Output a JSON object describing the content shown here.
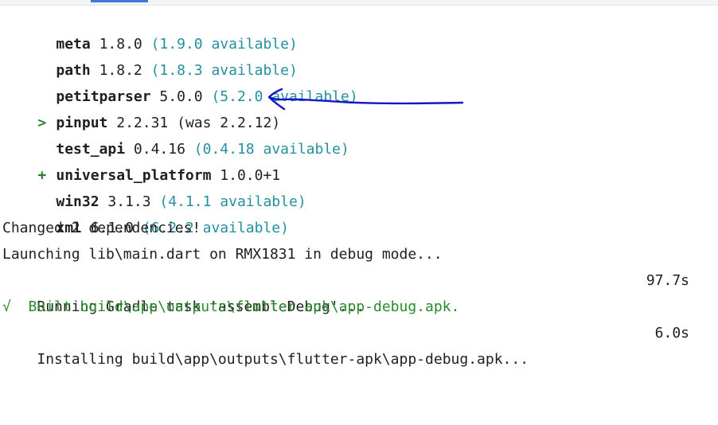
{
  "console": {
    "dependencies": [
      {
        "marker": "",
        "name": "meta",
        "version": "1.8.0",
        "available": "(1.9.0 available)",
        "note": ""
      },
      {
        "marker": "",
        "name": "path",
        "version": "1.8.2",
        "available": "(1.8.3 available)",
        "note": ""
      },
      {
        "marker": "",
        "name": "petitparser",
        "version": "5.0.0",
        "available": "(5.2.0 available)",
        "note": ""
      },
      {
        "marker": ">",
        "name": "pinput",
        "version": "2.2.31",
        "available": "",
        "note": "(was 2.2.12)"
      },
      {
        "marker": "",
        "name": "test_api",
        "version": "0.4.16",
        "available": "(0.4.18 available)",
        "note": ""
      },
      {
        "marker": "+",
        "name": "universal_platform",
        "version": "1.0.0+1",
        "available": "",
        "note": ""
      },
      {
        "marker": "",
        "name": "win32",
        "version": "3.1.3",
        "available": "(4.1.1 available)",
        "note": ""
      },
      {
        "marker": "",
        "name": "xml",
        "version": "6.1.0",
        "available": "(6.2.2 available)",
        "note": ""
      }
    ],
    "messages": {
      "changed": "Changed 2 dependencies!",
      "launching": "Launching lib\\main.dart on RMX1831 in debug mode...",
      "gradle": "Running Gradle task 'assembleDebug'...",
      "gradle_time": "97.7s",
      "built": "√  Built build\\app\\outputs\\flutter-apk\\app-debug.apk.",
      "installing": "Installing build\\app\\outputs\\flutter-apk\\app-debug.apk...",
      "install_time": "6.0s"
    }
  },
  "colors": {
    "available": "#23909e",
    "success": "#2b8a2b",
    "annotation_arrow": "#1616c8",
    "tab_accent": "#3d78d8"
  }
}
